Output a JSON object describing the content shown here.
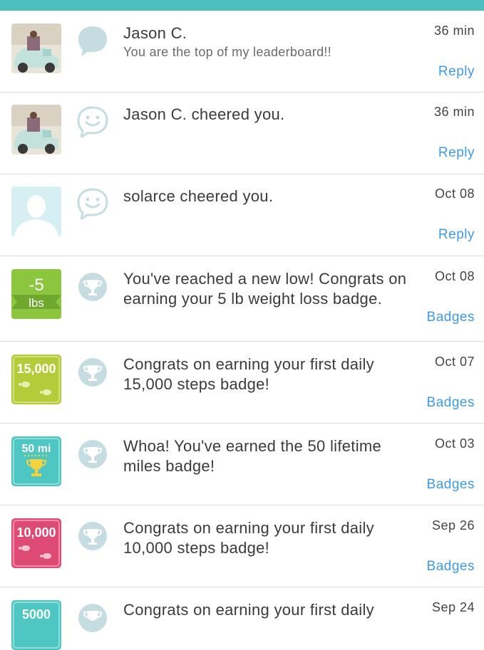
{
  "colors": {
    "header": "#4dbfbe",
    "link": "#3d9be9",
    "bubble": "#c5dde0",
    "badge_lbs": "#8cc63f",
    "badge_15000": "#b5cc3a",
    "badge_50mi": "#4ec6c2",
    "badge_10000": "#dd4b74",
    "badge_5000": "#4ec6c2"
  },
  "notifications": [
    {
      "name": "Jason C.",
      "message": "You are the top of my leaderboard!!",
      "time": "36 min",
      "action": "Reply",
      "avatar": "photo-car",
      "bubble_icon": "message-bubble-icon"
    },
    {
      "message": "Jason C. cheered you.",
      "time": "36 min",
      "action": "Reply",
      "avatar": "photo-car",
      "bubble_icon": "smiley-bubble-icon"
    },
    {
      "message": "solarce cheered you.",
      "time": "Oct 08",
      "action": "Reply",
      "avatar": "default-user",
      "bubble_icon": "smiley-bubble-icon"
    },
    {
      "message": "You've reached a new low! Congrats on earning your 5 lb weight loss badge.",
      "time": "Oct 08",
      "action": "Badges",
      "badge_top": "-5",
      "badge_bottom": "lbs",
      "bubble_icon": "trophy-bubble-icon"
    },
    {
      "message": "Congrats on earning your first daily 15,000 steps badge!",
      "time": "Oct 07",
      "action": "Badges",
      "badge_top": "15,000",
      "bubble_icon": "trophy-bubble-icon"
    },
    {
      "message": "Whoa! You've earned the 50 lifetime miles badge!",
      "time": "Oct 03",
      "action": "Badges",
      "badge_top": "50 mi",
      "bubble_icon": "trophy-bubble-icon"
    },
    {
      "message": "Congrats on earning your first daily 10,000 steps badge!",
      "time": "Sep 26",
      "action": "Badges",
      "badge_top": "10,000",
      "bubble_icon": "trophy-bubble-icon"
    },
    {
      "message": "Congrats on earning your first daily",
      "time": "Sep 24",
      "action": "",
      "badge_top": "5000",
      "bubble_icon": "trophy-bubble-icon"
    }
  ]
}
